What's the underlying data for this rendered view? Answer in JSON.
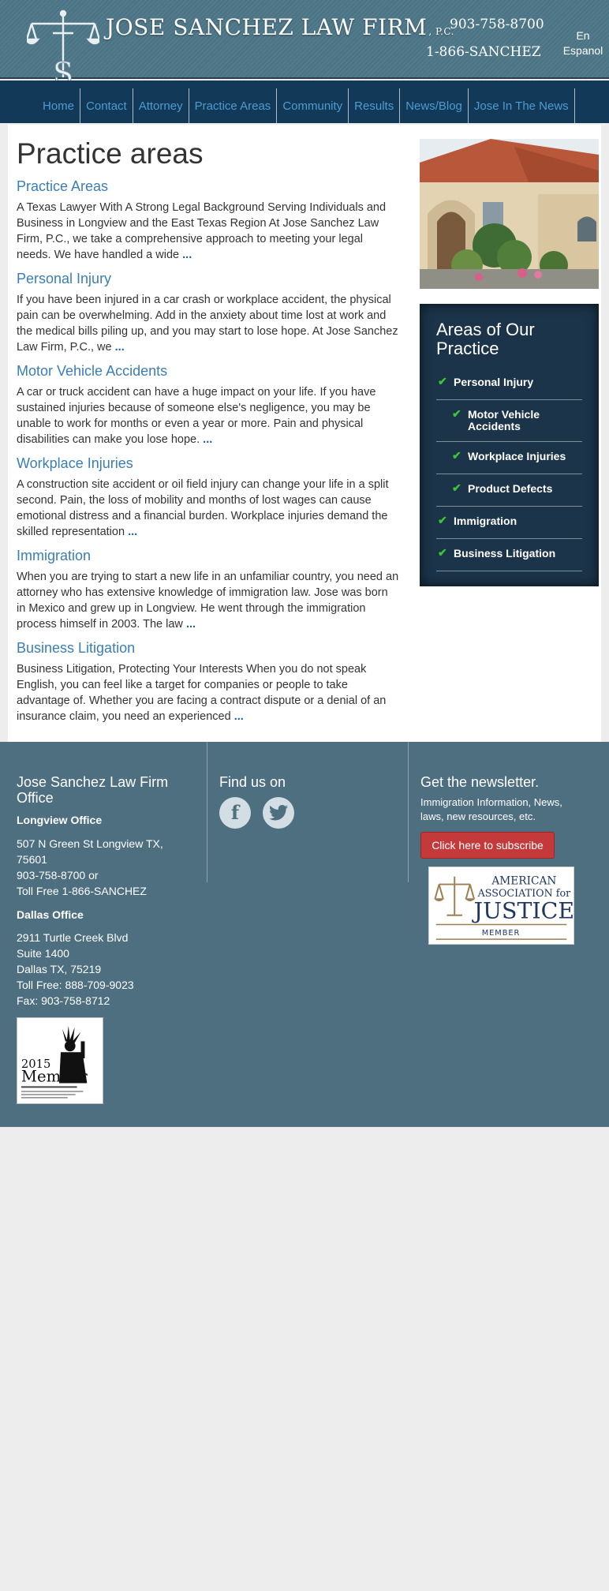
{
  "header": {
    "firm_name": "JOSE SANCHEZ LAW FIRM",
    "firm_suffix": ", P.C.",
    "phone_local": "903-758-8700",
    "phone_tollfree": "1-866-SANCHEZ",
    "language_link": "En Espanol",
    "logo_letter": "S"
  },
  "nav": {
    "items": [
      {
        "label": "Home"
      },
      {
        "label": "Contact"
      },
      {
        "label": "Attorney"
      },
      {
        "label": "Practice Areas"
      },
      {
        "label": "Community"
      },
      {
        "label": "Results"
      },
      {
        "label": "News/Blog"
      },
      {
        "label": "Jose In The News"
      }
    ]
  },
  "main": {
    "title": "Practice areas",
    "more_label": "...",
    "articles": [
      {
        "title": "Practice Areas",
        "text": "A Texas Lawyer With A Strong Legal Background Serving Individuals and Business in Longview and the East Texas Region At Jose Sanchez Law Firm, P.C., we take a comprehensive approach to meeting your legal needs. We have handled a wide"
      },
      {
        "title": "Personal Injury",
        "text": "If you have been injured in a car crash or workplace accident, the physical pain can be overwhelming. Add in the anxiety about time lost at work and the medical bills piling up, and you may start to lose hope. At Jose Sanchez Law Firm, P.C., we"
      },
      {
        "title": "Motor Vehicle Accidents",
        "text": "A car or truck accident can have a huge impact on your life. If you have sustained injuries because of someone else's negligence, you may be unable to work for months or even a year or more. Pain and physical disabilities can make you lose hope."
      },
      {
        "title": "Workplace Injuries",
        "text": "A construction site accident or oil field injury can change your life in a split second. Pain, the loss of mobility and months of lost wages can cause emotional distress and a financial burden. Workplace injuries demand the skilled representation"
      },
      {
        "title": "Immigration",
        "text": "When you are trying to start a new life in an unfamiliar country, you need an attorney who has extensive knowledge of immigration law. Jose was born in Mexico and grew up in Longview. He went through the immigration process himself in 2003. The law"
      },
      {
        "title": "Business Litigation",
        "text": "Business Litigation, Protecting Your Interests When you do not speak English, you can feel like a target for companies or people to take advantage of. Whether you are facing a contract dispute or a denial of an insurance claim, you need an experienced"
      }
    ]
  },
  "sidebar": {
    "heading": "Areas of Our Practice",
    "items": [
      {
        "label": "Personal Injury"
      },
      {
        "label": "Motor Vehicle Accidents"
      },
      {
        "label": "Workplace Injuries"
      },
      {
        "label": "Product Defects"
      },
      {
        "label": "Immigration"
      },
      {
        "label": "Business Litigation"
      }
    ]
  },
  "footer": {
    "office_heading": "Jose Sanchez Law Firm Office",
    "longview": {
      "title": "Longview Office",
      "lines": [
        "507 N Green St Longview TX,",
        "75601",
        "903-758-8700 or",
        "Toll Free 1-866-SANCHEZ"
      ]
    },
    "dallas": {
      "title": "Dallas Office",
      "lines": [
        "2911 Turtle Creek Blvd",
        "Suite 1400",
        "Dallas TX, 75219",
        "Toll Free: 888-709-9023",
        "Fax: 903-758-8712"
      ]
    },
    "member_badge": {
      "year": "2015",
      "word": "Member"
    },
    "find_us": "Find us on",
    "social": {
      "facebook_glyph": "f"
    },
    "newsletter": {
      "heading": "Get the newsletter.",
      "text": "Immigration Information, News, laws, new resources, etc.",
      "button": "Click here to subscribe"
    },
    "aaj": {
      "line1": "AMERICAN",
      "line2": "ASSOCIATION for",
      "line3": "JUSTICE",
      "line4": "MEMBER"
    }
  },
  "colors": {
    "nav_bg": "#123a58",
    "nav_link": "#4e9bd1",
    "heading_blue": "#3a7eb5",
    "sidebar_bg": "#1b3449",
    "check_green": "#3fc43a",
    "footer_bg": "#4d6f80",
    "subscribe_red": "#c43a3a"
  }
}
